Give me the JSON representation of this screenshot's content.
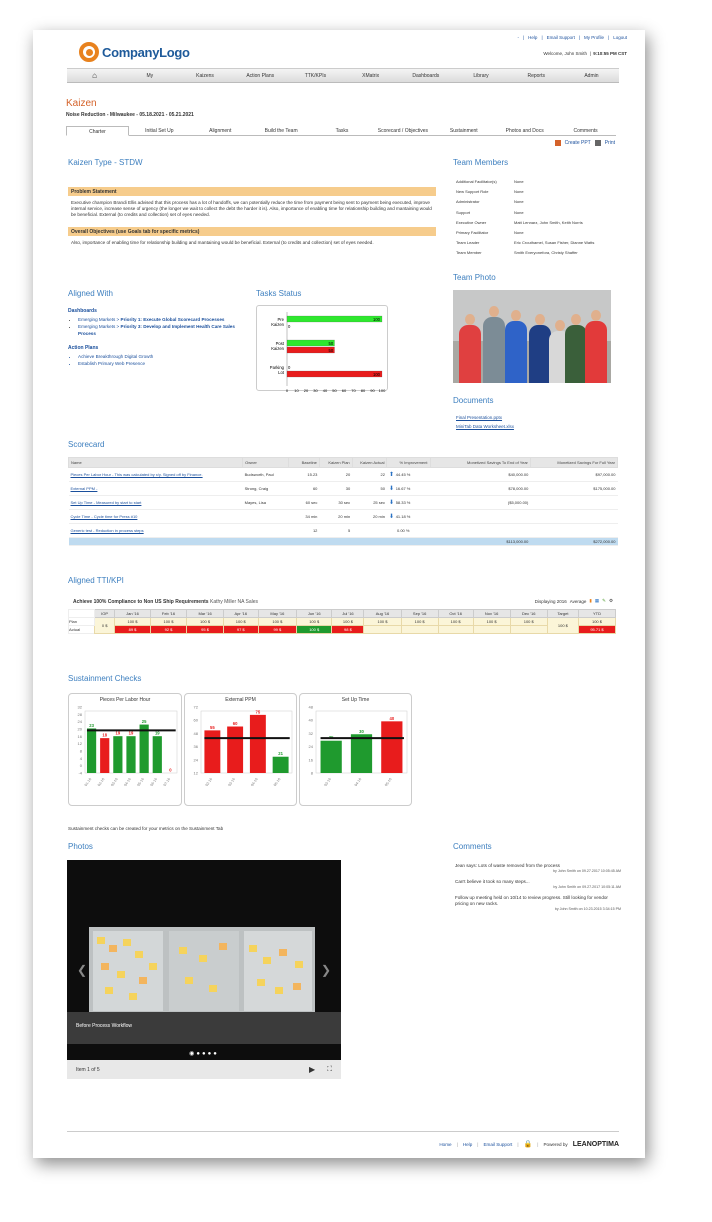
{
  "header": {
    "logo_text": "CompanyLogo",
    "top_links": [
      "-",
      "|",
      "Help",
      "|",
      "Email Support",
      "|",
      "My Profile",
      "|",
      "Logout"
    ],
    "welcome": "Welcome, John Smith",
    "time": "9:10:55 PM CST"
  },
  "nav": [
    "My",
    "Kaizens",
    "Action Plans",
    "TTK/KPIs",
    "XMatrix",
    "Dashboards",
    "Library",
    "Reports",
    "Admin"
  ],
  "page": {
    "title": "Kaizen",
    "subtitle": "Noise Reduction - Milwaukee - 05.18.2021 - 05.21.2021",
    "tabs": [
      "Charter",
      "Initial Set Up",
      "Alignment",
      "Build the Team",
      "Tasks",
      "Scorecard / Objectives",
      "Sustainment",
      "Photos and Docs",
      "Comments"
    ],
    "create_ppt": "Create PPT",
    "print": "Print"
  },
  "charter": {
    "kaizen_type": "Kaizen Type - STDW",
    "problem_title": "Problem Statement",
    "problem_text": "Executive champion Brandi Ellis advised that this process has a lot of handoffs, we can potentially reduce the time from payment being sent to payment being executed, improve internal service, increase sense of urgency (the longer we wait to collect the debt the harder it is). Also, importance of enabling time for relationship building and mantaining would be beneficial. External (to credits and collection) set of eyes needed.",
    "objectives_title": "Overall Objectives (use Goals tab for specific metrics)",
    "objectives_text": "Also, importance of enabling time for relationship building and mantaining would be beneficial. External (to credits and collection) set of eyes needed."
  },
  "team": {
    "title": "Team Members",
    "rows": [
      {
        "role": "Additional Facilitator(s)",
        "value": "None"
      },
      {
        "role": "New Support Role",
        "value": "None"
      },
      {
        "role": "Administrator",
        "value": "None"
      },
      {
        "role": "Support",
        "value": "None"
      },
      {
        "role": "Executive Owner",
        "value": "Matt Lennarz, John Smith, Keith Norris"
      },
      {
        "role": "Primary Facilitator",
        "value": "None"
      },
      {
        "role": "Team Leader",
        "value": "Eric Crouthamel, Susan Fisher, Dianne Watts"
      },
      {
        "role": "Team Member",
        "value": "Smith Everyonefora, Christy Shaffer"
      }
    ],
    "photo_title": "Team Photo"
  },
  "documents": {
    "title": "Documents",
    "items": [
      "Final Presentation.pptx",
      "MiniTab Data Worksheet.xlsx"
    ]
  },
  "aligned_with": {
    "title": "Aligned With",
    "dashboards_label": "Dashboards",
    "dashboards": [
      {
        "prefix": "Emerging Markets > ",
        "bold": "Priority 1: Execute Global Scorecard Processes"
      },
      {
        "prefix": "Emerging Markets > ",
        "bold": "Priority 3: Develop and Implement Health Care Sales Process"
      }
    ],
    "action_plans_label": "Action Plans",
    "action_plans": [
      "Achieve Breakthrough Digital Growth",
      "Establish Primary Web Presence"
    ]
  },
  "tasks_status": {
    "title": "Tasks Status",
    "chart_data": {
      "type": "bar",
      "orientation": "horizontal",
      "categories": [
        "Pre Kaizen",
        "Post Kaizen",
        "Parking Lot"
      ],
      "series": [
        {
          "values": [
            100,
            50,
            0
          ],
          "color": "#2ee82e"
        },
        {
          "values": [
            0,
            50,
            100
          ],
          "color": "#e81c1c"
        }
      ],
      "bar_labels": [
        [
          "100",
          "0"
        ],
        [
          "50",
          "50"
        ],
        [
          "0",
          "100"
        ]
      ],
      "xticks": [
        "0",
        "10",
        "20",
        "30",
        "40",
        "50",
        "60",
        "70",
        "80",
        "90",
        "100"
      ],
      "xlim": [
        0,
        100
      ]
    }
  },
  "scorecard": {
    "title": "Scorecard",
    "columns": [
      "Name",
      "Owner",
      "Baseline",
      "Kaizen Plan",
      "Kaizen Actual",
      "% Improvement",
      "Monetized Savings To End of Year",
      "Monetized Savings For Full Year"
    ],
    "rows": [
      {
        "name": "Pieces Per Labor Hour - This was calculated by x/y. Signed off by Finance.",
        "owner": "Budsworth, Paul",
        "baseline": "15.23",
        "plan": "20",
        "actual": "22",
        "dir": "up",
        "pct": "44.45 %",
        "eoy": "$40,000.00",
        "fy": "$97,000.00"
      },
      {
        "name": "External PPM -",
        "owner": "Strong, Craig",
        "baseline": "60",
        "plan": "30",
        "actual": "50",
        "dir": "down",
        "pct": "16.67 %",
        "eoy": "$78,000.00",
        "fy": "$175,000.00"
      },
      {
        "name": "Set Up Time - Measured by start to start",
        "owner": "Mayes, Lisa",
        "baseline": "60 sec",
        "plan": "30 sec",
        "actual": "25 sec",
        "dir": "down",
        "pct": "58.33 %",
        "eoy": "($5,000.00)",
        "fy": ""
      },
      {
        "name": "Cycle Time - Cycle time for Press #10",
        "owner": "",
        "baseline": "34 min",
        "plan": "20 min",
        "actual": "20 min",
        "dir": "down",
        "pct": "41.18 %",
        "eoy": "",
        "fy": ""
      },
      {
        "name": "Generic test - Reduction in process steps",
        "owner": "",
        "baseline": "12",
        "plan": "5",
        "actual": "",
        "dir": "",
        "pct": "0.00 %",
        "eoy": "",
        "fy": ""
      }
    ],
    "total_eoy": "$113,000.00",
    "total_fy": "$272,000.00"
  },
  "ttk": {
    "title": "Aligned TTI/KPI",
    "kpi_name": "Achieve 100% Compliance to Non US Ship Requirements",
    "owners": "Kathy Miller  NA Sales",
    "displaying": "Displaying 2016",
    "average": "Average",
    "columns": [
      "",
      "IOP",
      "Jan '16",
      "Feb '16",
      "Mar '16",
      "Apr '16",
      "May '16",
      "Jun '16",
      "Jul '16",
      "Aug '16",
      "Sep '16",
      "Oct '16",
      "Nov '16",
      "Dec '16",
      "Target",
      "YTD"
    ],
    "plan_label": "Plan",
    "actual_label": "Actual",
    "iop": "0 $",
    "plan": [
      "100 $",
      "100 $",
      "100 $",
      "100 $",
      "100 $",
      "100 $",
      "100 $",
      "100 $",
      "100 $",
      "100 $",
      "100 $",
      "100 $"
    ],
    "actual": [
      "89 $",
      "92 $",
      "95 $",
      "97 $",
      "99 $",
      "100 $",
      "98 $",
      "",
      "",
      "",
      "",
      ""
    ],
    "actual_status": [
      "red",
      "red",
      "red",
      "red",
      "red",
      "green",
      "red",
      "",
      "",
      "",
      "",
      ""
    ],
    "target": "100 $",
    "ytd_plan": "100 $",
    "ytd_actual": "95.71 $"
  },
  "sustainment": {
    "title": "Sustainment Checks",
    "note": "Sustainment checks can be created for your metrics on the Sustainment Tab",
    "chart_data": [
      {
        "type": "bar",
        "title": "Pieces Per Labor Hour",
        "categories": [
          "01-16",
          "02-16",
          "03-16",
          "04-16",
          "05-16",
          "06-16",
          "07-16"
        ],
        "values": [
          23,
          18,
          19,
          19,
          25,
          19,
          0
        ],
        "colors": [
          "#1f9a2e",
          "#e81c1c",
          "#1f9a2e",
          "#1f9a2e",
          "#1f9a2e",
          "#1f9a2e",
          "#e81c1c"
        ],
        "label_colors": [
          "#1f9a2e",
          "#e81c1c",
          "#e81c1c",
          "#e81c1c",
          "#1f9a2e",
          "#1f9a2e",
          "#e81c1c"
        ],
        "target": 22,
        "ylim": [
          0,
          32
        ],
        "yticks": [
          "-4",
          "0",
          "4",
          "8",
          "12",
          "16",
          "20",
          "24",
          "28",
          "32"
        ]
      },
      {
        "type": "bar",
        "title": "External PPM",
        "categories": [
          "02-16",
          "03-16",
          "04-16",
          "05-16"
        ],
        "values": [
          55,
          60,
          75,
          21
        ],
        "colors": [
          "#e81c1c",
          "#e81c1c",
          "#e81c1c",
          "#1f9a2e"
        ],
        "label_colors": [
          "#e81c1c",
          "#e81c1c",
          "#e81c1c",
          "#1f9a2e"
        ],
        "target": 45,
        "ylim": [
          0,
          80
        ],
        "yticks": [
          "12",
          "24",
          "36",
          "48",
          "60",
          "72"
        ]
      },
      {
        "type": "bar",
        "title": "Set Up Time",
        "categories": [
          "03-16",
          "04-16",
          "05-16"
        ],
        "values": [
          25,
          30,
          40
        ],
        "colors": [
          "#1f9a2e",
          "#1f9a2e",
          "#e81c1c"
        ],
        "label_colors": [
          "#1f9a2e",
          "#1f9a2e",
          "#e81c1c"
        ],
        "target": 27,
        "ylim": [
          0,
          48
        ],
        "yticks": [
          "8",
          "16",
          "24",
          "32",
          "40",
          "48"
        ]
      }
    ]
  },
  "photos": {
    "title": "Photos",
    "caption": "Before Process Workflow",
    "counter": "Item 1 of 5"
  },
  "comments": {
    "title": "Comments",
    "items": [
      {
        "text": "Jean says: Lots of waste removed from the process",
        "by": "by John Smith  on 09.27.2017 10:05:45 AM"
      },
      {
        "text": "Can't believe it took so many steps...",
        "by": "by John Smith  on 09.27.2017 10:05:11 AM"
      },
      {
        "text": "Follow up meeting held on 10/14 to review progress. Still looking for vendor pricing on new racks.",
        "by": "by John Smith  on 10.23.2015 3:34:15 PM"
      }
    ]
  },
  "footer": {
    "links": [
      "Home",
      "|",
      "Help",
      "|",
      "Email Support",
      "|"
    ],
    "powered": "Powered by",
    "brand": "LEANOPTIMA"
  }
}
